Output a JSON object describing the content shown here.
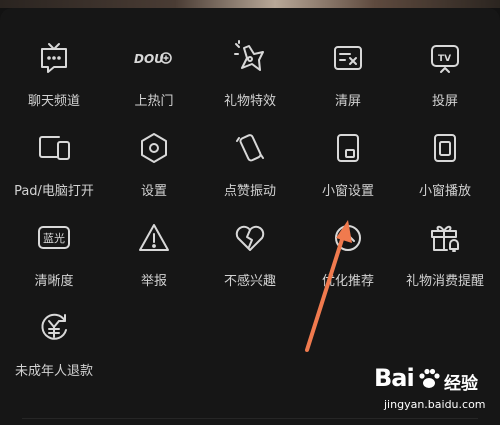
{
  "menu": {
    "items": [
      {
        "id": "chat",
        "label": "聊天频道",
        "icon": "tv-chat-icon"
      },
      {
        "id": "hot",
        "label": "上热门",
        "icon": "dou-plus-icon"
      },
      {
        "id": "gift-fx",
        "label": "礼物特效",
        "icon": "gift-effect-icon"
      },
      {
        "id": "clear",
        "label": "清屏",
        "icon": "clear-screen-icon"
      },
      {
        "id": "cast",
        "label": "投屏",
        "icon": "cast-tv-icon"
      },
      {
        "id": "pad",
        "label": "Pad/电脑打开",
        "icon": "devices-icon"
      },
      {
        "id": "settings",
        "label": "设置",
        "icon": "hexagon-settings-icon"
      },
      {
        "id": "vibrate",
        "label": "点赞振动",
        "icon": "vibrate-icon"
      },
      {
        "id": "pip-settings",
        "label": "小窗设置",
        "icon": "small-window-icon"
      },
      {
        "id": "pip-play",
        "label": "小窗播放",
        "icon": "small-window-play-icon"
      },
      {
        "id": "quality",
        "label": "清晰度",
        "icon": "quality-badge-icon",
        "badge": "蓝光"
      },
      {
        "id": "report",
        "label": "举报",
        "icon": "warning-icon"
      },
      {
        "id": "not-interested",
        "label": "不感兴趣",
        "icon": "broken-heart-icon"
      },
      {
        "id": "optimize",
        "label": "优化推荐",
        "icon": "optimize-icon"
      },
      {
        "id": "gift-remind",
        "label": "礼物消费提醒",
        "icon": "gift-bell-icon"
      },
      {
        "id": "refund",
        "label": "未成年人退款",
        "icon": "refund-yuan-icon"
      }
    ],
    "dou_text": "DOU"
  },
  "watermark": {
    "brand": "Bai",
    "brand2": "经验",
    "url": "jingyan.baidu.com"
  },
  "colors": {
    "background": "#161616",
    "icon": "#d8d8d8",
    "text": "#d2d2d2",
    "arrow": "#f07a4e"
  }
}
